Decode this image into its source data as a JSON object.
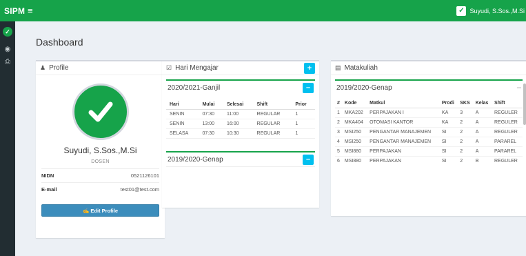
{
  "topbar": {
    "brand": "SIPM",
    "menu_icon": "≡",
    "user_name": "Suyudi, S.Sos.,M.Si"
  },
  "sidebar": {
    "avatar_icon": "check-icon",
    "items": [
      {
        "icon": "dashboard-icon"
      },
      {
        "icon": "print-icon"
      }
    ]
  },
  "page": {
    "title": "Dashboard"
  },
  "profile": {
    "title": "Profile",
    "name": "Suyudi, S.Sos.,M.Si",
    "role": "DOSEN",
    "nidn_label": "NIDN",
    "nidn_value": "0521126101",
    "email_label": "E-mail",
    "email_value": "test01@test.com",
    "edit_label": "✍ Edit Profile"
  },
  "hari": {
    "title": "Hari Mengajar",
    "add_label": "+",
    "periods": [
      {
        "title": "2020/2021-Ganjil",
        "toggle": "–",
        "headers": [
          "Hari",
          "Mulai",
          "Selesai",
          "Shift",
          "Prior"
        ],
        "rows": [
          [
            "SENIN",
            "07:30",
            "11:00",
            "REGULAR",
            "1"
          ],
          [
            "SENIN",
            "13:00",
            "16:00",
            "REGULAR",
            "1"
          ],
          [
            "SELASA",
            "07:30",
            "10:30",
            "REGULAR",
            "1"
          ]
        ]
      },
      {
        "title": "2019/2020-Genap",
        "toggle": "–"
      }
    ]
  },
  "matakuliah": {
    "title": "Matakuliah",
    "period": "2019/2020-Genap",
    "toggle": "–",
    "headers": [
      "#",
      "Kode",
      "Matkul",
      "Prodi",
      "SKS",
      "Kelas",
      "Shift"
    ],
    "rows": [
      [
        "1",
        "MKA202",
        "PERPAJAKAN I",
        "KA",
        "3",
        "A",
        "REGULER"
      ],
      [
        "2",
        "MKA404",
        "OTOMASI KANTOR",
        "KA",
        "2",
        "A",
        "REGULER"
      ],
      [
        "3",
        "MSI250",
        "PENGANTAR MANAJEMEN",
        "SI",
        "2",
        "A",
        "REGULER"
      ],
      [
        "4",
        "MSI250",
        "PENGANTAR MANAJEMEN",
        "SI",
        "2",
        "A",
        "PARAREL"
      ],
      [
        "5",
        "MSI880",
        "PERPAJAKAN",
        "SI",
        "2",
        "A",
        "PARAREL"
      ],
      [
        "6",
        "MSI880",
        "PERPAJAKAN",
        "SI",
        "2",
        "B",
        "REGULER"
      ]
    ]
  }
}
